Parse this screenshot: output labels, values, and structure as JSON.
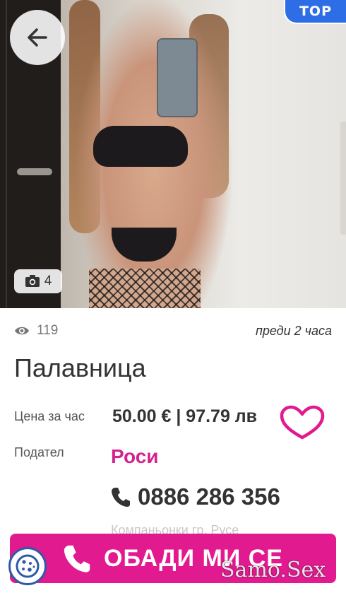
{
  "listing": {
    "badge": "TOP",
    "photo_count": "4",
    "views": "119",
    "posted": "преди 2 часа",
    "city": "Палавница",
    "price_label": "Цена за час",
    "price_value": "50.00 € | 97.79 лв",
    "provider_label": "Подател",
    "provider_name": "Роси",
    "phone": "0886 286 356",
    "category_faded": "Компаньонки гр. Русе"
  },
  "actions": {
    "call_label": "ОБАДИ МИ СЕ"
  },
  "watermark": "Samo.Sex",
  "colors": {
    "accent": "#e11a8f",
    "provider": "#d4228f",
    "badge": "#2d6ee6"
  },
  "icons": [
    "back-arrow-icon",
    "camera-icon",
    "eye-icon",
    "heart-icon",
    "phone-icon",
    "cookie-icon"
  ]
}
